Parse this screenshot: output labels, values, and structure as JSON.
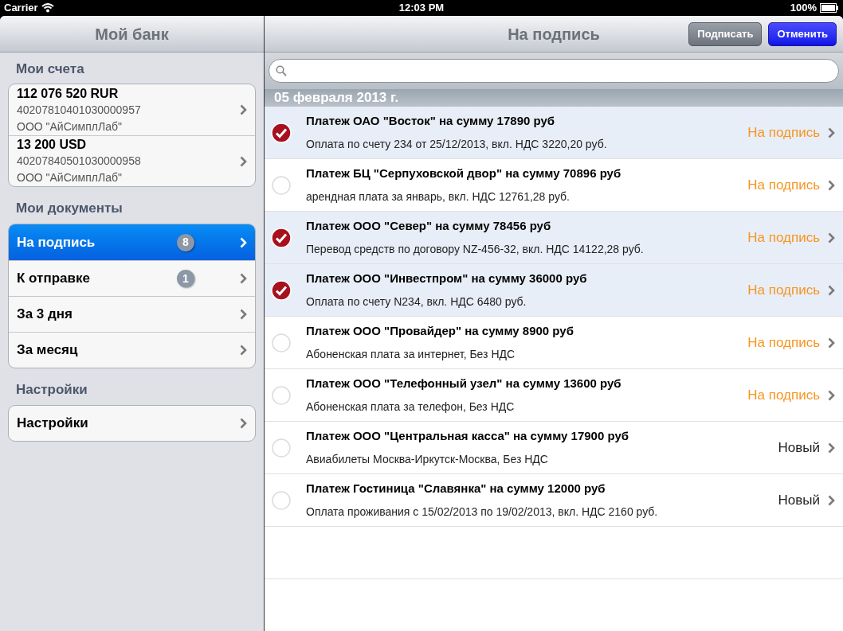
{
  "status_bar": {
    "carrier": "Carrier",
    "time": "12:03 PM",
    "battery": "100%"
  },
  "sidebar": {
    "title": "Мой банк",
    "accounts_header": "Мои счета",
    "accounts": [
      {
        "amount": "112 076 520 RUR",
        "number": "40207810401030000957",
        "owner": "ООО \"АйСимплЛаб\""
      },
      {
        "amount": "13 200 USD",
        "number": "40207840501030000958",
        "owner": "ООО \"АйСимплЛаб\""
      }
    ],
    "documents_header": "Мои документы",
    "documents": [
      {
        "label": "На подпись",
        "badge": "8",
        "selected": true
      },
      {
        "label": "К отправке",
        "badge": "1",
        "selected": false
      },
      {
        "label": "За 3 дня",
        "selected": false
      },
      {
        "label": "За месяц",
        "selected": false
      }
    ],
    "settings_header": "Настройки",
    "settings": [
      {
        "label": "Настройки"
      }
    ]
  },
  "main": {
    "title": "На подпись",
    "buttons": [
      {
        "label": "Подписать",
        "kind": "secondary"
      },
      {
        "label": "Отменить",
        "kind": "primary"
      }
    ],
    "section_date": "05 февраля 2013 г.",
    "rows": [
      {
        "title": "Платеж ОАО \"Восток\" на сумму 17890 руб",
        "subtitle": "Оплата по счету 234 от 25/12/2013, вкл. НДС 3220,20 руб.",
        "status": "На подпись",
        "kind": "pending",
        "checked": true
      },
      {
        "title": "Платеж БЦ \"Серпуховской двор\" на сумму 70896 руб",
        "subtitle": "арендная плата за январь, вкл. НДС 12761,28 руб.",
        "status": "На подпись",
        "kind": "pending",
        "checked": false
      },
      {
        "title": "Платеж ООО \"Север\" на сумму 78456 руб",
        "subtitle": "Перевод средств по договору NZ-456-32, вкл. НДС 14122,28 руб.",
        "status": "На подпись",
        "kind": "pending",
        "checked": true
      },
      {
        "title": "Платеж ООО \"Инвестпром\" на сумму 36000 руб",
        "subtitle": "Оплата по счету N234, вкл. НДС 6480 руб.",
        "status": "На подпись",
        "kind": "pending",
        "checked": true
      },
      {
        "title": "Платеж ООО \"Провайдер\" на сумму 8900 руб",
        "subtitle": "Абоненская плата за интернет, Без НДС",
        "status": "На подпись",
        "kind": "pending",
        "checked": false
      },
      {
        "title": "Платеж ООО \"Телефонный узел\" на сумму 13600 руб",
        "subtitle": "Абоненская плата за телефон, Без НДС",
        "status": "На подпись",
        "kind": "pending",
        "checked": false
      },
      {
        "title": "Платеж ООО \"Центральная касса\" на сумму 17900 руб",
        "subtitle": "Авиабилеты Москва-Иркутск-Москва, Без НДС",
        "status": "Новый",
        "kind": "new",
        "checked": false
      },
      {
        "title": "Платеж Гостиница \"Славянка\" на сумму 12000 руб",
        "subtitle": "Оплата проживания с 15/02/2013 по 19/02/2013, вкл. НДС 2160 руб.",
        "status": "Новый",
        "kind": "new",
        "checked": false
      }
    ]
  }
}
